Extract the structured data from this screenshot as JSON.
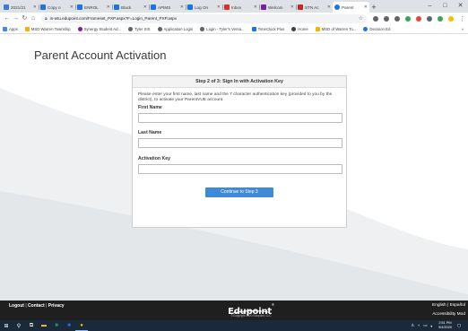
{
  "browser": {
    "tabs": [
      {
        "label": "2021/21",
        "color": "#3b7bd4",
        "active": false
      },
      {
        "label": "Copy o",
        "color": "#1a73e8",
        "active": false
      },
      {
        "label": "ENROL",
        "color": "#1a73e8",
        "active": false
      },
      {
        "label": "Black",
        "color": "#1a73e8",
        "active": false
      },
      {
        "label": "APIMS",
        "color": "#1a73e8",
        "active": false
      },
      {
        "label": "Log On",
        "color": "#1a73e8",
        "active": false
      },
      {
        "label": "Inbox",
        "color": "#d93025",
        "active": false
      },
      {
        "label": "Welcom",
        "color": "#7b1fa2",
        "active": false
      },
      {
        "label": "STN Ac",
        "color": "#c62828",
        "active": false
      },
      {
        "label": "Parent",
        "color": "#1a73e8",
        "active": true
      }
    ],
    "new_tab_glyph": "+",
    "window_controls": {
      "minimize": "–",
      "maximize": "□",
      "close": "✕"
    },
    "url": "in-wtu.edupoint.com/Frameset_PXP.aspx?F=Login_Parent_PXP.aspx",
    "extension_colors": [
      "#5f6368",
      "#5f6368",
      "#5f6368",
      "#34a853",
      "#ea4335",
      "#5f6368",
      "#34a853",
      "#fbbc04"
    ],
    "bookmarks": [
      {
        "label": "Apps",
        "color": "#4285f4"
      },
      {
        "label": "MSD Warren Township",
        "color": "#f4b400"
      },
      {
        "label": "Synergy Student Ad...",
        "color": "#7b1fa2"
      },
      {
        "label": "Tyler SIS",
        "color": "#5f6368"
      },
      {
        "label": "Application Login",
        "color": "#5f6368"
      },
      {
        "label": "Login - Tyler's Versa...",
        "color": "#5f6368"
      },
      {
        "label": "TimeClock Plus",
        "color": "#1a73e8"
      },
      {
        "label": "Home",
        "color": "#3c4043"
      },
      {
        "label": "MSD of Warren To...",
        "color": "#f4b400"
      },
      {
        "label": "Decision Ed",
        "color": "#1a73e8"
      }
    ],
    "bookmarks_more": "»"
  },
  "page": {
    "title": "Parent Account Activation",
    "card": {
      "heading": "Step 2 of 3: Sign In with Activation Key",
      "instructions": "Please enter your first name, last name and the 7 character authentication key (provided to you by the district), to activate your ParentVUE account.",
      "first_name_label": "First Name",
      "last_name_label": "Last Name",
      "activation_key_label": "Activation Key",
      "continue_label": "Continue to Step 3"
    }
  },
  "footer": {
    "logout": "Logout",
    "contact": "Contact",
    "privacy": "Privacy",
    "separator": "|",
    "brand": "Edupoint",
    "brand_mark": "®",
    "copyright": "©Copyright 2020 Edupoint, LLC",
    "english": "English",
    "espanol": "Español",
    "accessibility": "Accessibility Mod"
  },
  "taskbar": {
    "time": "2:51 PM",
    "date": "9/4/2020",
    "accent": "#1b2a3a"
  },
  "colors": {
    "primary_button": "#3e8ad8",
    "footer_bg": "#1f1f1f",
    "swoosh": "#eef0f2"
  }
}
